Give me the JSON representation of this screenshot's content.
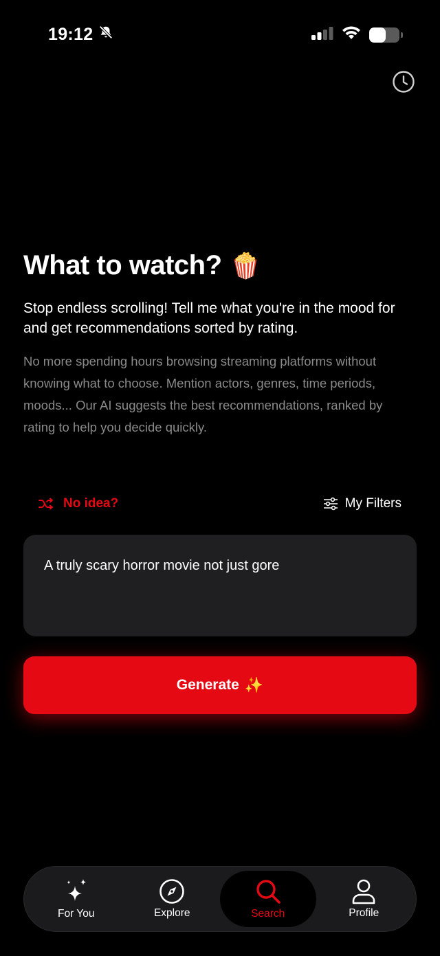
{
  "status_bar": {
    "time": "19:12",
    "battery_level": 0.55
  },
  "header": {
    "history_icon": "clock-history-icon"
  },
  "hero": {
    "title": "What to watch?",
    "title_emoji": "🍿",
    "subtitle": "Stop endless scrolling! Tell me what you're in the mood for and get recommendations sorted by rating.",
    "description": "No more spending hours browsing streaming platforms without knowing what to choose. Mention actors, genres, time periods, moods... Our AI suggests the best recommendations, ranked by rating to help you decide quickly."
  },
  "actions": {
    "no_idea_label": "No idea?",
    "my_filters_label": "My Filters"
  },
  "prompt": {
    "value": "A truly scary horror movie not just gore"
  },
  "generate": {
    "label": "Generate",
    "emoji": "✨"
  },
  "tabs": [
    {
      "label": "For You",
      "icon": "sparkles-icon"
    },
    {
      "label": "Explore",
      "icon": "compass-icon"
    },
    {
      "label": "Search",
      "icon": "search-icon",
      "active": true
    },
    {
      "label": "Profile",
      "icon": "person-icon"
    }
  ],
  "colors": {
    "accent": "#e50914",
    "background": "#000000",
    "input_bg": "#1f1f22",
    "muted_text": "#8a8a8a"
  }
}
